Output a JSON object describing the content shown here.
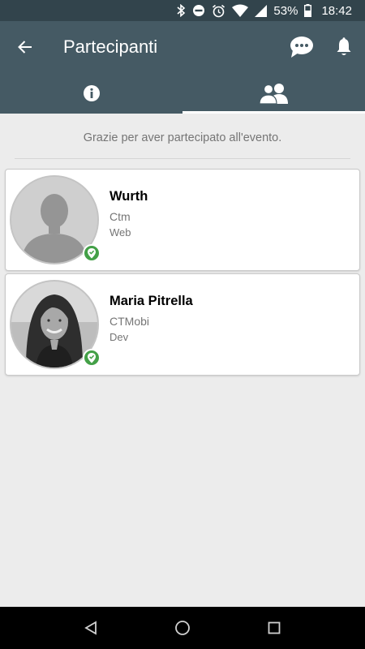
{
  "status_bar": {
    "battery_percent": "53%",
    "time": "18:42",
    "icons": [
      "bluetooth-icon",
      "do-not-disturb-icon",
      "alarm-icon",
      "wifi-icon",
      "signal-icon",
      "battery-icon"
    ]
  },
  "app_bar": {
    "title": "Partecipanti",
    "back_icon": "arrow-back-icon",
    "actions": [
      "chat-icon",
      "bell-icon"
    ]
  },
  "tabs": [
    {
      "icon": "info-icon",
      "active": false
    },
    {
      "icon": "people-icon",
      "active": true
    }
  ],
  "content": {
    "thanks_message": "Grazie per aver partecipato all'evento."
  },
  "participants": [
    {
      "name": "Wurth",
      "company": "Ctm",
      "role": "Web",
      "avatar": "placeholder-person",
      "badge": "check-in-icon"
    },
    {
      "name": "Maria Pitrella",
      "company": "CTMobi",
      "role": "Dev",
      "avatar": "photo",
      "badge": "check-in-icon"
    }
  ],
  "nav_bar": {
    "buttons": [
      "back-triangle-icon",
      "home-circle-icon",
      "recents-square-icon"
    ]
  },
  "colors": {
    "status_bar": "#32444c",
    "app_bar": "#455a64",
    "background": "#ececec",
    "badge": "#43a047"
  }
}
